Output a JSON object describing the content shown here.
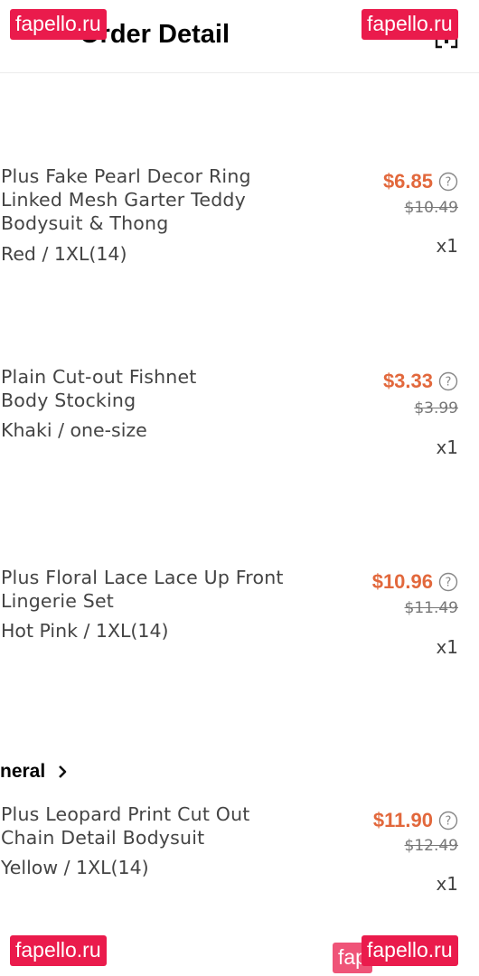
{
  "header": {
    "title": "Order Detail"
  },
  "items": [
    {
      "name_lines": [
        "Plus Fake Pearl Decor Ring",
        "Linked Mesh Garter Teddy",
        "Bodysuit & Thong"
      ],
      "variant": "Red / 1XL(14)",
      "price": "$6.85",
      "original_price": "$10.49",
      "quantity": "x1"
    },
    {
      "name_lines": [
        "Plain Cut-out Fishnet",
        "Body Stocking"
      ],
      "variant": "Khaki / one-size",
      "price": "$3.33",
      "original_price": "$3.99",
      "quantity": "x1"
    },
    {
      "name_lines": [
        "Plus Floral Lace Lace Up Front",
        "Lingerie Set"
      ],
      "variant": "Hot Pink / 1XL(14)",
      "price": "$10.96",
      "original_price": "$11.49",
      "quantity": "x1"
    },
    {
      "name_lines": [
        "Plus Leopard Print Cut Out",
        "Chain Detail Bodysuit"
      ],
      "variant": "Yellow / 1XL(14)",
      "price": "$11.90",
      "original_price": "$12.49",
      "quantity": "x1"
    }
  ],
  "section": {
    "label": "neral"
  },
  "watermarks": [
    "fapello.ru",
    "fapello.ru",
    "fapello.ru",
    "fapello.ru",
    "fap"
  ],
  "colors": {
    "price": "#e2683c",
    "watermark": "#ea1b4c"
  },
  "icons": {
    "header": "support-icon",
    "price_help": "question-circle-icon",
    "section": "chevron-right-icon"
  }
}
